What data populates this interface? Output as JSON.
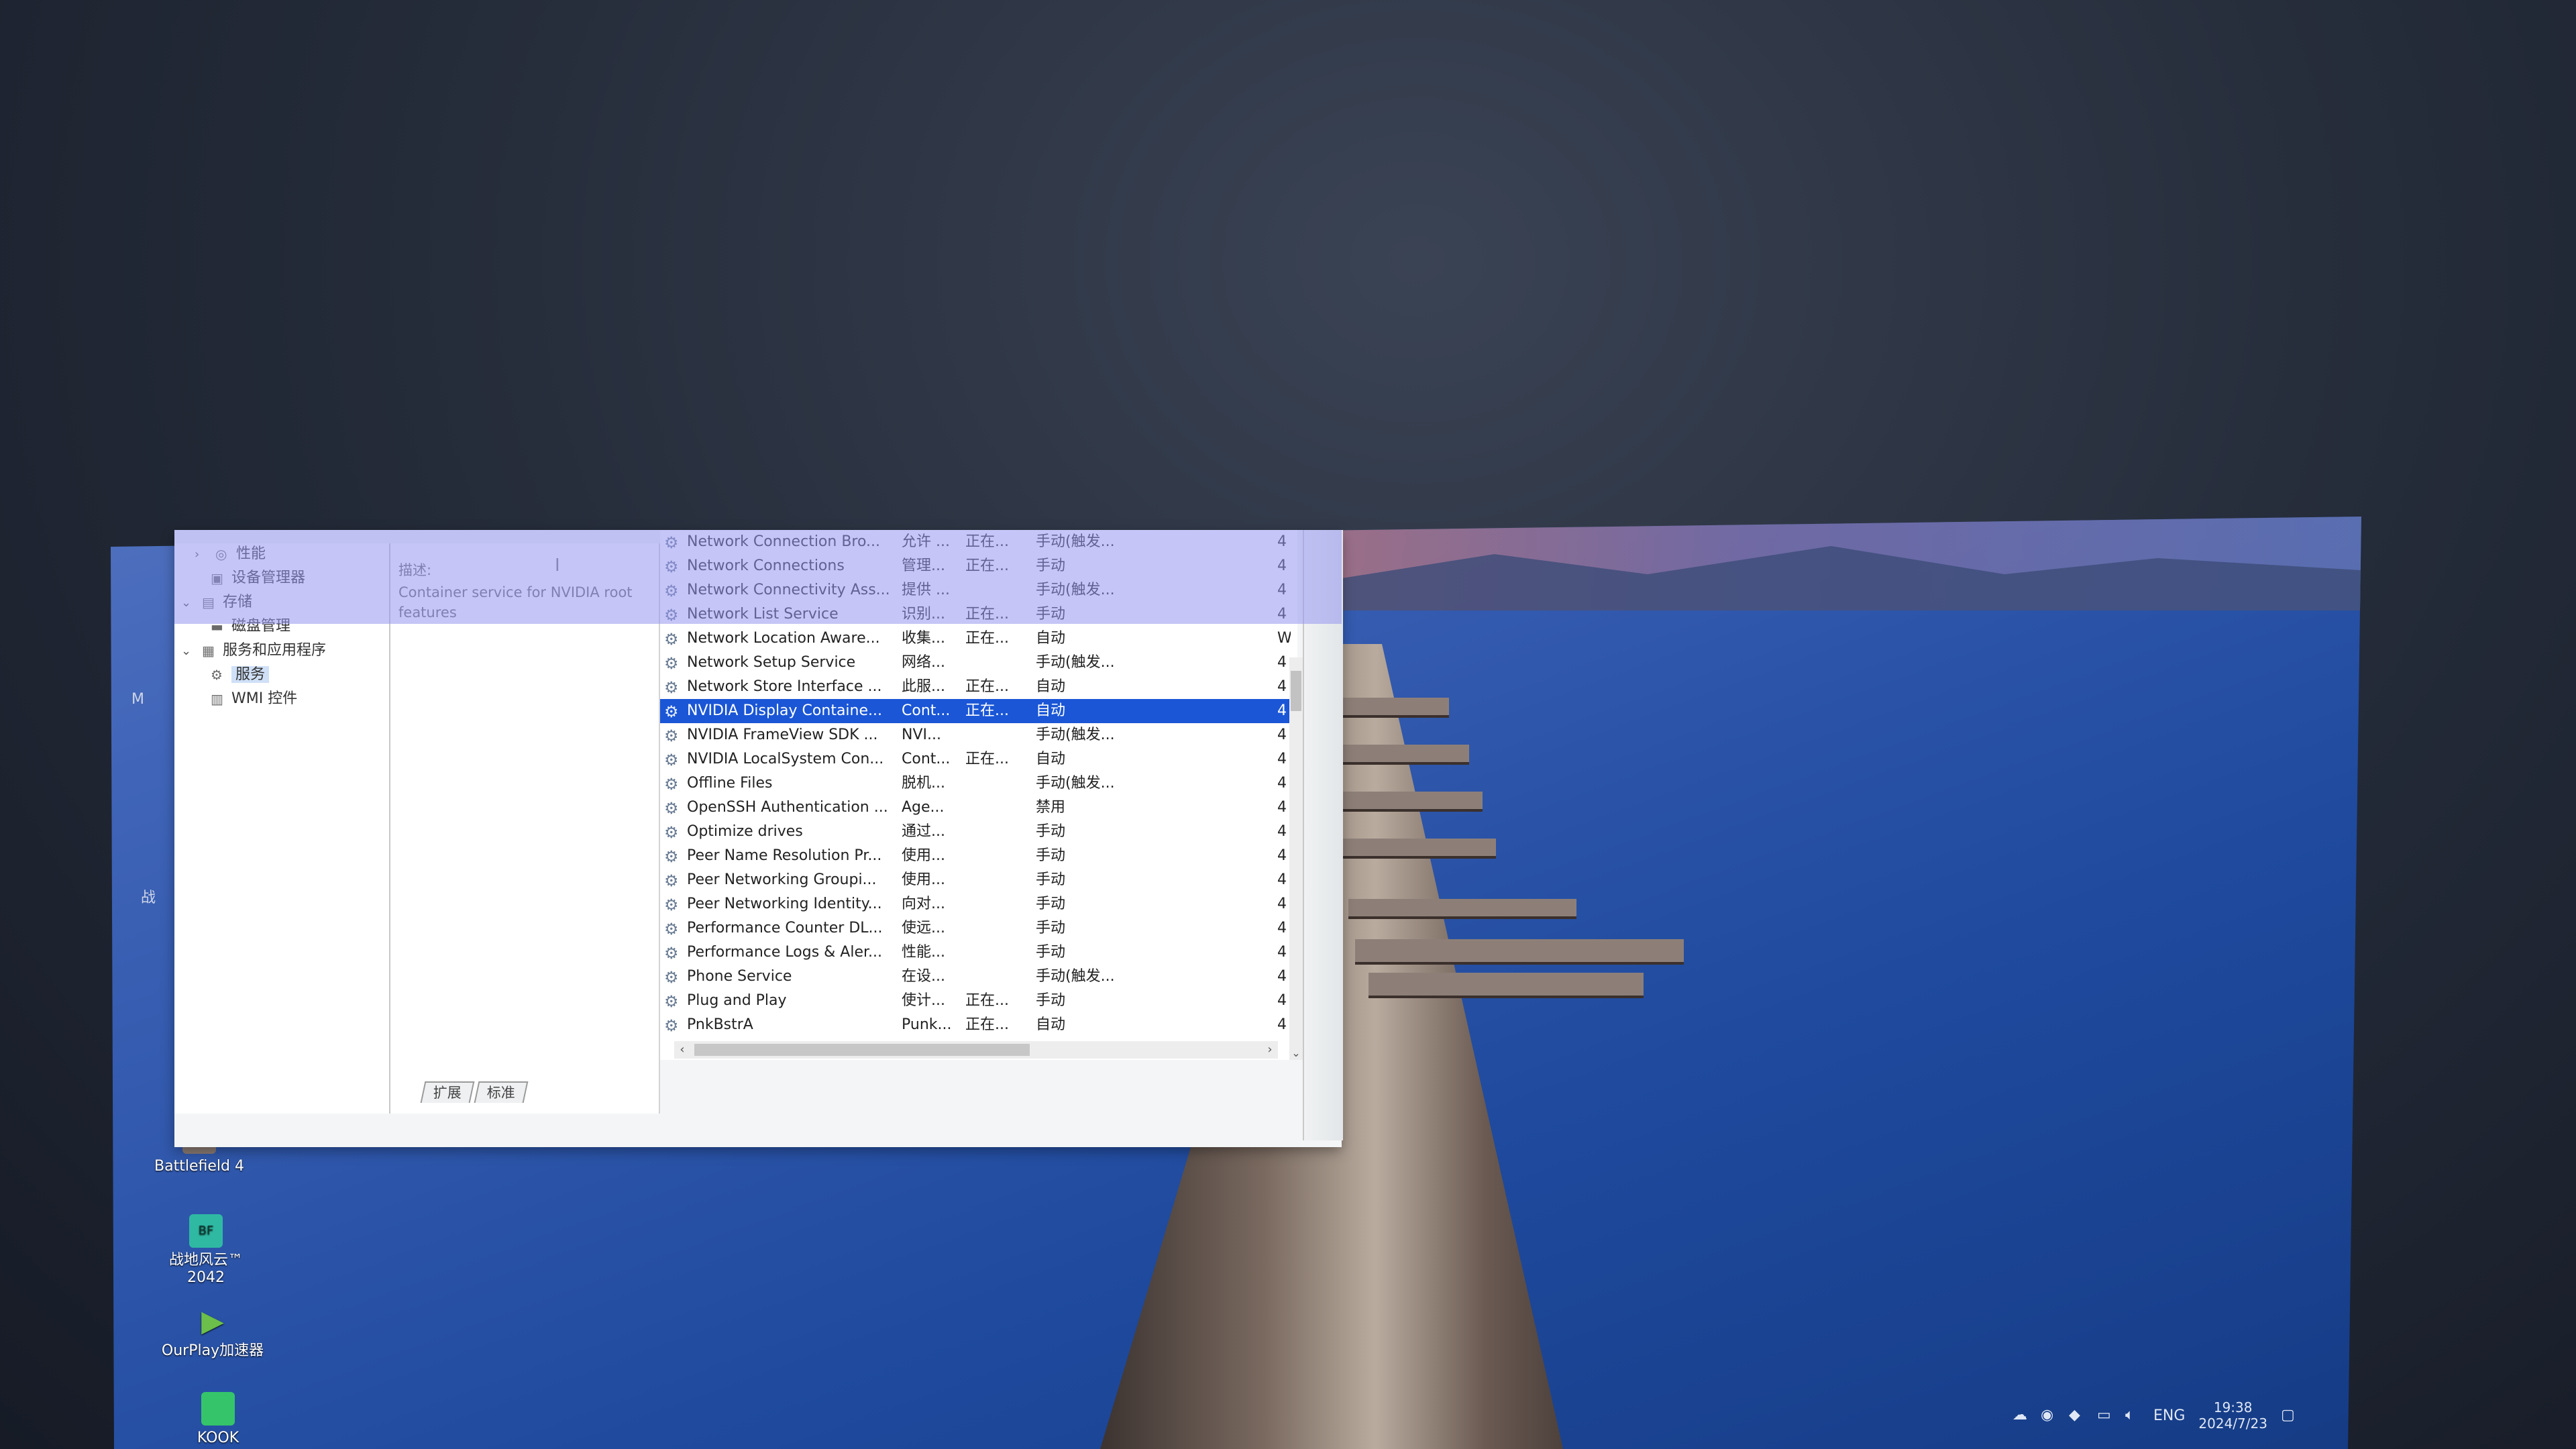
{
  "tree": {
    "items": [
      {
        "chevron": ">",
        "icon": "performance-icon",
        "label": "性能",
        "indent": 1
      },
      {
        "chevron": "",
        "icon": "device-manager-icon",
        "label": "设备管理器",
        "indent": 1
      },
      {
        "chevron": "v",
        "icon": "storage-icon",
        "label": "存储",
        "indent": 0
      },
      {
        "chevron": "",
        "icon": "disk-icon",
        "label": "磁盘管理",
        "indent": 1
      },
      {
        "chevron": "v",
        "icon": "services-apps-icon",
        "label": "服务和应用程序",
        "indent": 0
      },
      {
        "chevron": "",
        "icon": "services-icon",
        "label": "服务",
        "indent": 1,
        "selected": true
      },
      {
        "chevron": "",
        "icon": "wmi-icon",
        "label": "WMI 控件",
        "indent": 1
      }
    ]
  },
  "description": {
    "heading": "描述:",
    "text": "Container service for NVIDIA root features"
  },
  "services": [
    {
      "name": "Network Connection Bro...",
      "desc": "允许 ...",
      "status": "正在...",
      "start": "手动(触发...",
      "login": "4"
    },
    {
      "name": "Network Connections",
      "desc": "管理...",
      "status": "正在...",
      "start": "手动",
      "login": "4"
    },
    {
      "name": "Network Connectivity Ass...",
      "desc": "提供 ...",
      "status": "",
      "start": "手动(触发...",
      "login": "4"
    },
    {
      "name": "Network List Service",
      "desc": "识别...",
      "status": "正在...",
      "start": "手动",
      "login": "4"
    },
    {
      "name": "Network Location Aware...",
      "desc": "收集...",
      "status": "正在...",
      "start": "自动",
      "login": "W"
    },
    {
      "name": "Network Setup Service",
      "desc": "网络...",
      "status": "",
      "start": "手动(触发...",
      "login": "4"
    },
    {
      "name": "Network Store Interface ...",
      "desc": "此服...",
      "status": "正在...",
      "start": "自动",
      "login": "4"
    },
    {
      "name": "NVIDIA Display Containe...",
      "desc": "Cont...",
      "status": "正在...",
      "start": "自动",
      "login": "4",
      "selected": true
    },
    {
      "name": "NVIDIA FrameView SDK ...",
      "desc": "NVI...",
      "status": "",
      "start": "手动(触发...",
      "login": "4"
    },
    {
      "name": "NVIDIA LocalSystem Con...",
      "desc": "Cont...",
      "status": "正在...",
      "start": "自动",
      "login": "4"
    },
    {
      "name": "Offline Files",
      "desc": "脱机...",
      "status": "",
      "start": "手动(触发...",
      "login": "4"
    },
    {
      "name": "OpenSSH Authentication ...",
      "desc": "Age...",
      "status": "",
      "start": "禁用",
      "login": "4"
    },
    {
      "name": "Optimize drives",
      "desc": "通过...",
      "status": "",
      "start": "手动",
      "login": "4"
    },
    {
      "name": "Peer Name Resolution Pr...",
      "desc": "使用...",
      "status": "",
      "start": "手动",
      "login": "4"
    },
    {
      "name": "Peer Networking Groupi...",
      "desc": "使用...",
      "status": "",
      "start": "手动",
      "login": "4"
    },
    {
      "name": "Peer Networking Identity...",
      "desc": "向对...",
      "status": "",
      "start": "手动",
      "login": "4"
    },
    {
      "name": "Performance Counter DL...",
      "desc": "使远...",
      "status": "",
      "start": "手动",
      "login": "4"
    },
    {
      "name": "Performance Logs & Aler...",
      "desc": "性能...",
      "status": "",
      "start": "手动",
      "login": "4"
    },
    {
      "name": "Phone Service",
      "desc": "在设...",
      "status": "",
      "start": "手动(触发...",
      "login": "4"
    },
    {
      "name": "Plug and Play",
      "desc": "使计...",
      "status": "正在...",
      "start": "手动",
      "login": "4"
    },
    {
      "name": "PnkBstrA",
      "desc": "Punk...",
      "status": "正在...",
      "start": "自动",
      "login": "4"
    }
  ],
  "tabs": [
    "扩展",
    "标准"
  ],
  "desktop": {
    "icons": [
      {
        "label": "Battlefield 4",
        "icon": "battlefield4-icon",
        "color": "#8a7a72"
      },
      {
        "label": "战地风云™ 2042",
        "icon": "bf2042-icon",
        "color": "#2fb9a3"
      },
      {
        "label": "OurPlay加速器",
        "icon": "ourplay-icon",
        "color": "#6bbf4a"
      },
      {
        "label": "KOOK",
        "icon": "kook-icon",
        "color": "#35c46a"
      }
    ],
    "edge_text_1": "M",
    "edge_text_2": "战"
  },
  "tray": {
    "language": "ENG",
    "time": "19:38",
    "date": "2024/7/23"
  },
  "colors": {
    "selection": "#1a56d6",
    "wallpaper_top": "#6f86c9",
    "wallpaper_bottom": "#143a82"
  }
}
